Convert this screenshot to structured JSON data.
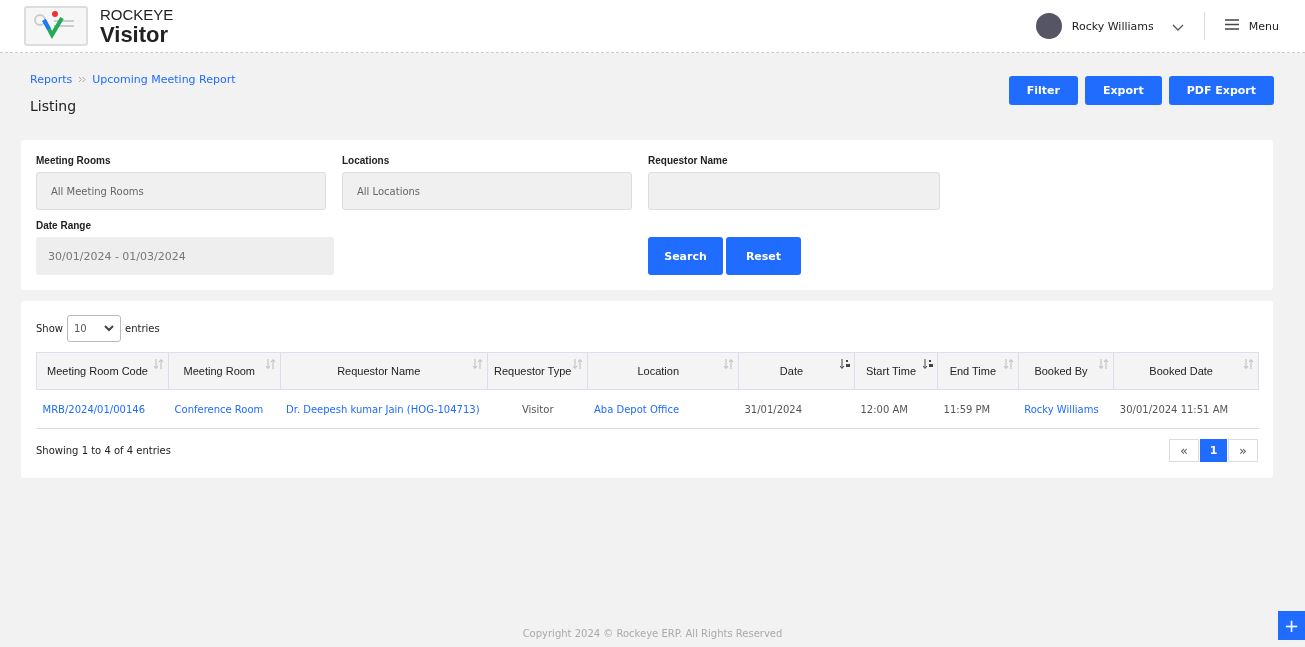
{
  "header": {
    "brand_top": "ROCKEYE",
    "brand_bottom": "Visitor",
    "user": {
      "name": "Rocky Williams"
    },
    "menu_label": "Menu"
  },
  "breadcrumb": [
    "Reports",
    "Upcoming Meeting Report"
  ],
  "page_title": "Listing",
  "actions": [
    "Filter",
    "Export",
    "PDF Export"
  ],
  "filters": {
    "fields": [
      {
        "label": "Meeting Rooms",
        "kind": "select",
        "value": "All Meeting Rooms"
      },
      {
        "label": "Locations",
        "kind": "select",
        "value": "All Locations"
      },
      {
        "label": "Requestor Name",
        "kind": "input"
      },
      {
        "label": "Date Range",
        "kind": "date",
        "value": "30/01/2024 - 01/03/2024"
      }
    ],
    "buttons": [
      "Search",
      "Reset"
    ]
  },
  "table": {
    "show_label": "Show",
    "page_size": "10",
    "entries_label": "entries",
    "columns": [
      {
        "label": "Meeting Room Code",
        "sorted": false
      },
      {
        "label": "Meeting Room",
        "sorted": false
      },
      {
        "label": "Requestor Name",
        "sorted": false
      },
      {
        "label": "Requestor Type",
        "sorted": false
      },
      {
        "label": "Location",
        "sorted": false
      },
      {
        "label": "Date",
        "sorted": true
      },
      {
        "label": "Start Time",
        "sorted": true
      },
      {
        "label": "End Time",
        "sorted": false
      },
      {
        "label": "Booked By",
        "sorted": false
      },
      {
        "label": "Booked Date",
        "sorted": false
      }
    ],
    "rows": [
      [
        {
          "text": "MRB/2024/01/00146",
          "kind": "link"
        },
        {
          "text": "Conference Room",
          "kind": "link"
        },
        {
          "text": "Dr. Deepesh kumar Jain (HOG-104713)",
          "kind": "link"
        },
        {
          "text": "Visitor",
          "kind": "center"
        },
        {
          "text": "Aba Depot Office",
          "kind": "link"
        },
        {
          "text": "31/01/2024",
          "kind": "text"
        },
        {
          "text": "12:00 AM",
          "kind": "text"
        },
        {
          "text": "11:59 PM",
          "kind": "text"
        },
        {
          "text": "Rocky Williams",
          "kind": "link"
        },
        {
          "text": "30/01/2024 11:51 AM",
          "kind": "text"
        }
      ]
    ],
    "info": "Showing 1 to 4 of 4 entries",
    "pages": [
      {
        "label": "«",
        "selected": false
      },
      {
        "label": "1",
        "selected": true
      },
      {
        "label": "»",
        "selected": false
      }
    ]
  },
  "footer": "Copyright 2024 © Rockeye ERP. All Rights Reserved",
  "fab": "+"
}
